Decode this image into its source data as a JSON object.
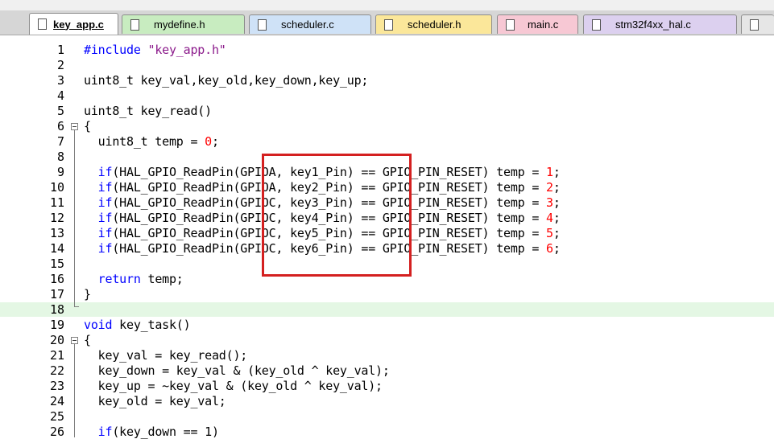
{
  "tabs": [
    {
      "label": "key_app.c",
      "active": true,
      "color": "#ffffff"
    },
    {
      "label": "mydefine.h",
      "active": false,
      "color": "#c8ecc0"
    },
    {
      "label": "scheduler.c",
      "active": false,
      "color": "#cfe2f7"
    },
    {
      "label": "scheduler.h",
      "active": false,
      "color": "#fbe79a"
    },
    {
      "label": "main.c",
      "active": false,
      "color": "#f7c8d4"
    },
    {
      "label": "stm32f4xx_hal.c",
      "active": false,
      "color": "#dcd0ef"
    }
  ],
  "line_numbers": [
    "1",
    "2",
    "3",
    "4",
    "5",
    "6",
    "7",
    "8",
    "9",
    "10",
    "11",
    "12",
    "13",
    "14",
    "15",
    "16",
    "17",
    "18",
    "19",
    "20",
    "21",
    "22",
    "23",
    "24",
    "25",
    "26"
  ],
  "code": {
    "l1_pp": "#include",
    "l1_str": " \"key_app.h\"",
    "l3": "uint8_t key_val,key_old,key_down,key_up;",
    "l5": "uint8_t key_read()",
    "l6": "{",
    "l7_a": "  uint8_t temp = ",
    "l7_num": "0",
    "l7_b": ";",
    "reads": [
      {
        "kw": "  if",
        "mid": "(HAL_GPIO_ReadPin(GPIOA, key1_Pin) == GPIO_PIN_RESET) temp = ",
        "num": "1",
        "end": ";"
      },
      {
        "kw": "  if",
        "mid": "(HAL_GPIO_ReadPin(GPIOA, key2_Pin) == GPIO_PIN_RESET) temp = ",
        "num": "2",
        "end": ";"
      },
      {
        "kw": "  if",
        "mid": "(HAL_GPIO_ReadPin(GPIOC, key3_Pin) == GPIO_PIN_RESET) temp = ",
        "num": "3",
        "end": ";"
      },
      {
        "kw": "  if",
        "mid": "(HAL_GPIO_ReadPin(GPIOC, key4_Pin) == GPIO_PIN_RESET) temp = ",
        "num": "4",
        "end": ";"
      },
      {
        "kw": "  if",
        "mid": "(HAL_GPIO_ReadPin(GPIOC, key5_Pin) == GPIO_PIN_RESET) temp = ",
        "num": "5",
        "end": ";"
      },
      {
        "kw": "  if",
        "mid": "(HAL_GPIO_ReadPin(GPIOC, key6_Pin) == GPIO_PIN_RESET) temp = ",
        "num": "6",
        "end": ";"
      }
    ],
    "l16_kw": "  return",
    "l16_b": " temp;",
    "l17": "}",
    "l19_kw": "void",
    "l19_b": " key_task()",
    "l20": "{",
    "l21": "  key_val = key_read();",
    "l22": "  key_down = key_val & (key_old ^ key_val);",
    "l23": "  key_up = ~key_val & (key_old ^ key_val);",
    "l24": "  key_old = key_val;",
    "l26_kw": "  if",
    "l26_b": "(key_down == 1)"
  },
  "highlight_color": "#e4f7e4",
  "annotation_color": "#d42020"
}
